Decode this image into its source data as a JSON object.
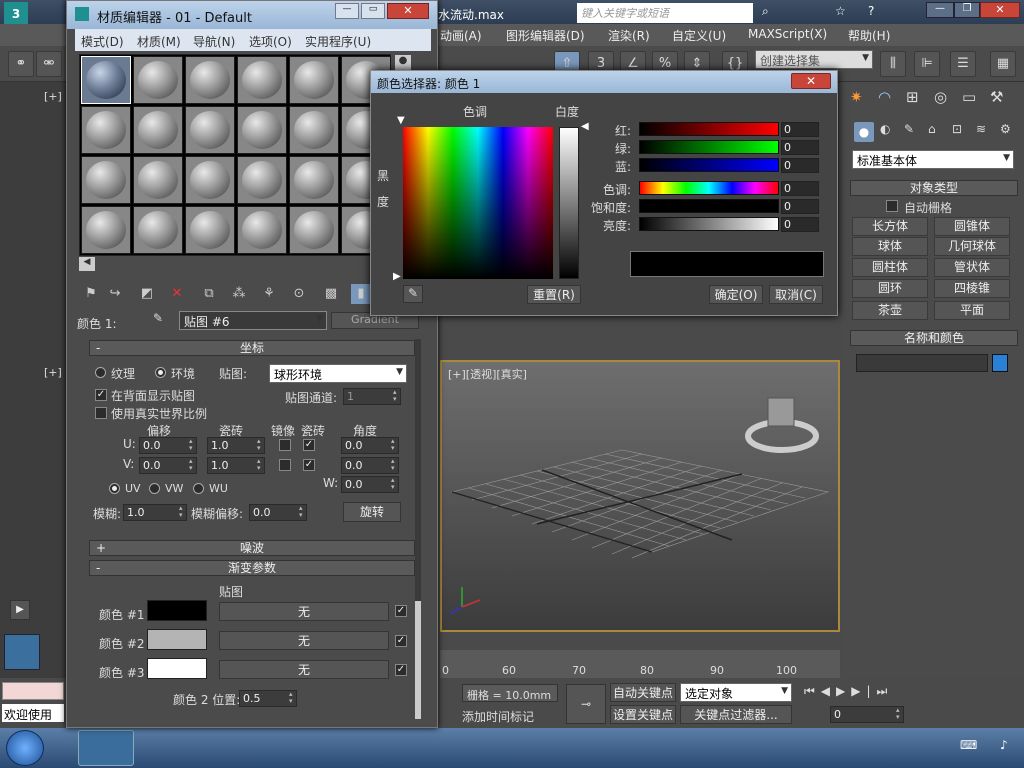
{
  "app": {
    "filename": "水流动.max",
    "search_placeholder": "键入关键字或短语",
    "menu": [
      "动画(A)",
      "图形编辑器(D)",
      "渲染(R)",
      "自定义(U)",
      "MAXScript(X)",
      "帮助(H)"
    ],
    "selection_set_placeholder": "创建选择集",
    "viewport_top_label": "[+]",
    "viewport_persp_label": "[+][透视][真实]",
    "timeline_ticks": [
      "60",
      "70",
      "80",
      "90",
      "100"
    ],
    "timeline_start": "0",
    "grid_label": "栅格 = 10.0mm",
    "auto_key": "自动关键点",
    "set_key": "设置关键点",
    "selected_object": "选定对象",
    "key_filters": "关键点过滤器...",
    "add_time_tag": "添加时间标记",
    "frame_value": "0",
    "status_welcome": "欢迎使用"
  },
  "command_panel": {
    "category": "标准基本体",
    "object_type_header": "对象类型",
    "auto_grid_label": "自动栅格",
    "buttons": [
      "长方体",
      "圆锥体",
      "球体",
      "几何球体",
      "圆柱体",
      "管状体",
      "圆环",
      "四棱锥",
      "茶壶",
      "平面"
    ],
    "name_color_header": "名称和颜色",
    "name_color_swatch": "#2a7fd6"
  },
  "material_editor": {
    "title": "材质编辑器 - 01 - Default",
    "menu": [
      "模式(D)",
      "材质(M)",
      "导航(N)",
      "选项(O)",
      "实用程序(U)"
    ],
    "color_label": "颜色 1:",
    "map_name": "贴图 #6",
    "map_type": "Gradient",
    "coords": {
      "header": "坐标",
      "texture_label": "纹理",
      "environ_label": "环境",
      "mapping_label": "贴图:",
      "mapping_value": "球形环境",
      "show_map_on_back": "在背面显示贴图",
      "map_channel_label": "贴图通道:",
      "map_channel_value": "1",
      "real_world_scale": "使用真实世界比例",
      "col_offset": "偏移",
      "col_tiling": "瓷砖",
      "col_mirror": "镜像",
      "col_tile": "瓷砖",
      "col_angle": "角度",
      "u_label": "U:",
      "v_label": "V:",
      "w_label": "W:",
      "u_offset": "0.0",
      "v_offset": "0.0",
      "u_tiling": "1.0",
      "v_tiling": "1.0",
      "u_angle": "0.0",
      "v_angle": "0.0",
      "w_angle": "0.0",
      "uv_label": "UV",
      "vw_label": "VW",
      "wu_label": "WU",
      "blur_label": "模糊:",
      "blur_value": "1.0",
      "blur_offset_label": "模糊偏移:",
      "blur_offset_value": "0.0",
      "rotate_button": "旋转"
    },
    "noise_header": "噪波",
    "gradient": {
      "header": "渐变参数",
      "map_col": "贴图",
      "colors": [
        {
          "label": "颜色 #1",
          "color": "#000000",
          "map": "无"
        },
        {
          "label": "颜色 #2",
          "color": "#b4b4b4",
          "map": "无"
        },
        {
          "label": "颜色 #3",
          "color": "#ffffff",
          "map": "无"
        }
      ],
      "color2_pos_label": "颜色 2 位置:",
      "color2_pos_value": "0.5"
    }
  },
  "color_picker": {
    "title": "颜色选择器: 颜色 1",
    "hue_label": "色调",
    "whiteness_label": "白度",
    "blackness_label": "黑",
    "blackness_label2": "度",
    "red_label": "红:",
    "green_label": "绿:",
    "blue_label": "蓝:",
    "hue_label2": "色调:",
    "sat_label": "饱和度:",
    "bright_label": "亮度:",
    "red": "0",
    "green": "0",
    "blue": "0",
    "hue": "0",
    "saturation": "0",
    "brightness": "0",
    "reset": "重置(R)",
    "ok": "确定(O)",
    "cancel": "取消(C)"
  }
}
